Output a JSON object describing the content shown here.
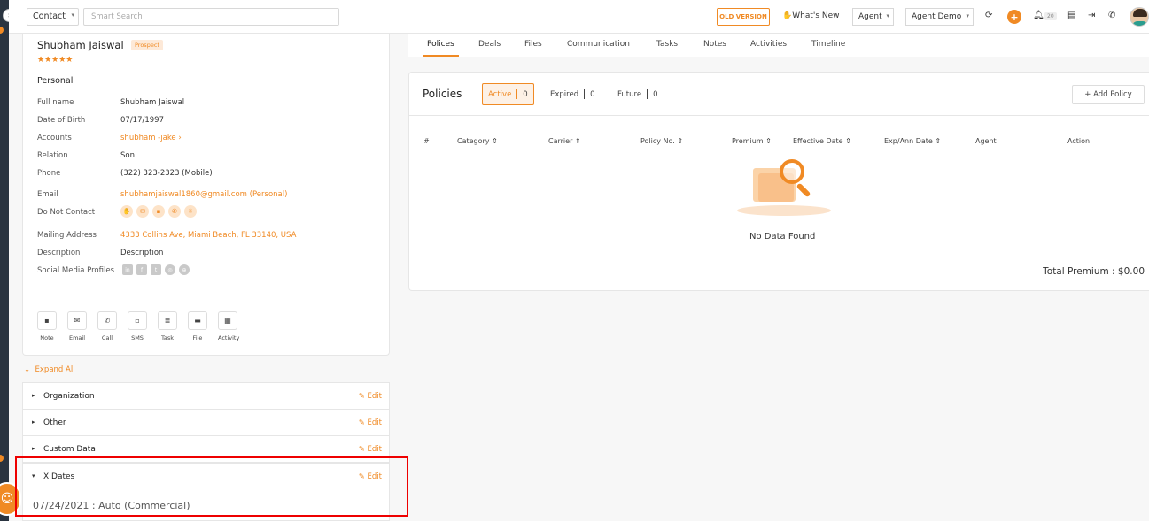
{
  "topbar": {
    "contact_select": "Contact",
    "search_placeholder": "Smart Search",
    "old_version": "OLD VERSION",
    "whats_new": "What's New",
    "agent_select": "Agent",
    "agent_demo": "Agent Demo",
    "notif_count": "20"
  },
  "contact": {
    "name": "Shubham Jaiswal",
    "badge": "Prospect",
    "rating": "★★★★★",
    "section": "Personal",
    "fields": [
      {
        "label": "Full name",
        "value": "Shubham Jaiswal"
      },
      {
        "label": "Date of Birth",
        "value": "07/17/1997"
      },
      {
        "label": "Accounts",
        "value": "shubham -jake ›"
      },
      {
        "label": "Relation",
        "value": "Son"
      },
      {
        "label": "Phone",
        "value": "(322) 323-2323 (Mobile)"
      },
      {
        "label": "Email",
        "value": "shubhamjaiswal1860@gmail.com  (Personal)"
      },
      {
        "label": "Do Not Contact",
        "value": ""
      },
      {
        "label": "Mailing Address",
        "value": "4333 Collins Ave, Miami Beach, FL 33140, USA"
      },
      {
        "label": "Description",
        "value": "Description"
      },
      {
        "label": "Social Media Profiles",
        "value": ""
      }
    ],
    "actions": [
      "Note",
      "Email",
      "Call",
      "SMS",
      "Task",
      "File",
      "Activity"
    ]
  },
  "accordion": {
    "expand_all": "Expand All",
    "edit_label": "Edit",
    "sections": [
      "Organization",
      "Other",
      "Custom Data",
      "X Dates"
    ],
    "xdates_value": "07/24/2021 : Auto (Commercial)"
  },
  "tabs": [
    "Polices",
    "Deals",
    "Files",
    "Communication",
    "Tasks",
    "Notes",
    "Activities",
    "Timeline"
  ],
  "policies": {
    "title": "Policies",
    "statuses": [
      {
        "label": "Active",
        "count": "0"
      },
      {
        "label": "Expired",
        "count": "0"
      },
      {
        "label": "Future",
        "count": "0"
      }
    ],
    "add_button": "+  Add Policy",
    "columns": [
      "#",
      "Category ⇕",
      "Carrier ⇕",
      "Policy No. ⇕",
      "Premium ⇕",
      "Effective Date ⇕",
      "Exp/Ann Date ⇕",
      "Agent",
      "Action"
    ],
    "empty_text": "No Data Found",
    "total": "Total Premium : $0.00"
  }
}
